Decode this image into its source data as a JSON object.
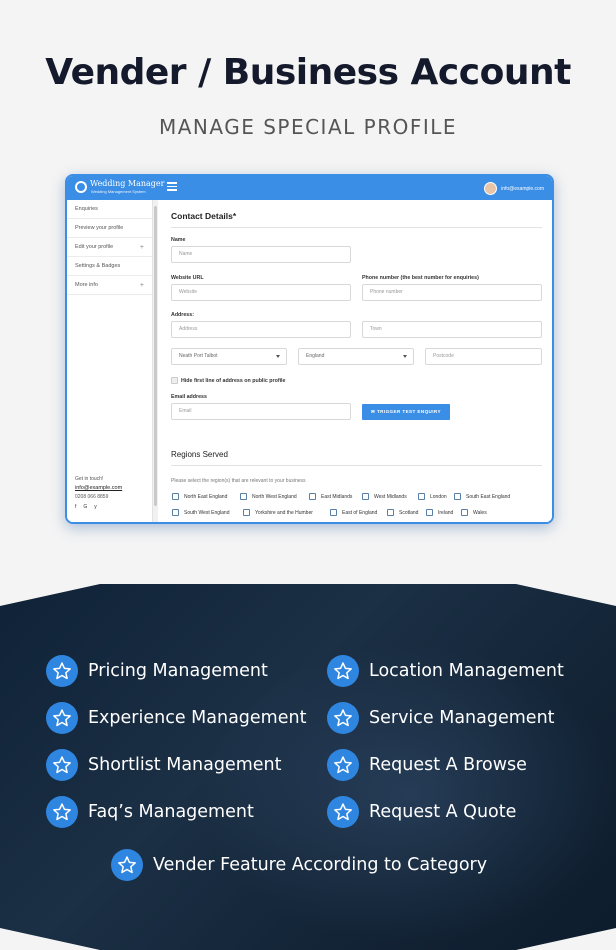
{
  "header": {
    "title": "Vender / Business Account",
    "subtitle": "MANAGE SPECIAL PROFILE"
  },
  "app": {
    "brand_name": "Wedding Manager",
    "brand_tagline": "Wedding Management System",
    "user_email": "info@example.com",
    "accent": "#3a8ee6",
    "sidebar": {
      "items": [
        {
          "label": "Enquiries",
          "expandable": false
        },
        {
          "label": "Preview your profile",
          "expandable": false
        },
        {
          "label": "Edit your profile",
          "expandable": true
        },
        {
          "label": "Settings & Badges",
          "expandable": false
        },
        {
          "label": "More info",
          "expandable": true
        }
      ],
      "footer": {
        "get_in_touch": "Get in touch!",
        "email": "info@example.com",
        "phone": "0208 066 8859",
        "social": [
          "f",
          "G",
          "y"
        ]
      }
    },
    "form": {
      "section_title": "Contact Details*",
      "name_label": "Name",
      "name_placeholder": "Name",
      "website_label": "Website URL",
      "website_placeholder": "Website",
      "phone_label": "Phone number (the best number for enquiries)",
      "phone_placeholder": "Phone number",
      "address_label": "Address:",
      "address_placeholder": "Address",
      "town_placeholder": "Town",
      "county_value": "Neath Port Talbot",
      "country_value": "England",
      "postcode_placeholder": "Postcode",
      "hide_address_label": "Hide first line of address on public profile",
      "email_label": "Email address",
      "email_placeholder": "Email",
      "trigger_button": "TRIGGER TEST ENQUIRY"
    },
    "regions": {
      "title": "Regions Served",
      "hint": "Please select the region(s) that are relevant to your business",
      "row1": [
        "North East England",
        "North West England",
        "East Midlands",
        "West Midlands",
        "London",
        "South East England"
      ],
      "row2": [
        "South West England",
        "Yorkshire and the Humber",
        "East of England",
        "Scotland",
        "Ireland",
        "Wales"
      ]
    }
  },
  "features": {
    "left": [
      "Pricing Management",
      "Experience Management",
      "Shortlist Management",
      "Faq’s Management"
    ],
    "right": [
      "Location Management",
      "Service Management",
      "Request A Browse",
      "Request A Quote"
    ],
    "center": "Vender Feature According to Category",
    "icon": "star-icon",
    "icon_color": "#2f86e0"
  }
}
